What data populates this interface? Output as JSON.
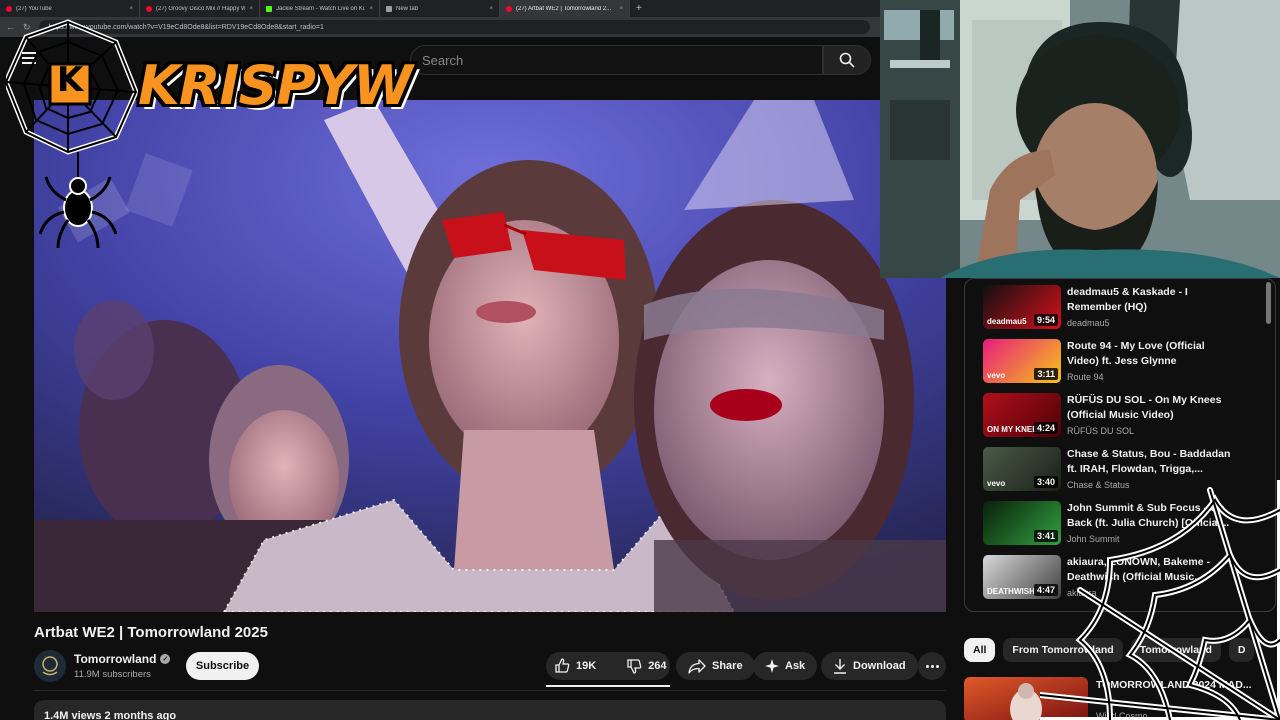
{
  "browser": {
    "tabs": [
      {
        "label": "(27) YouTube",
        "icon": "youtube-favicon",
        "active": false
      },
      {
        "label": "(27) Groovy Disco Mix // Happy W...",
        "icon": "youtube-favicon",
        "active": false
      },
      {
        "label": "Jackie Stream - Watch Live on Ki...",
        "icon": "kick-favicon",
        "active": false
      },
      {
        "label": "New tab",
        "icon": "blank-favicon",
        "active": false
      },
      {
        "label": "(27) Artbat WE2 | Tomorrowland 2...",
        "icon": "youtube-favicon",
        "active": true
      }
    ],
    "new_tab_label": "+",
    "url": "https://www.youtube.com/watch?v=V19eCd8Ode8&list=RDV19eCd8Ode8&start_radio=1"
  },
  "header": {
    "search_placeholder": "Search"
  },
  "video": {
    "title": "Artbat WE2 | Tomorrowland 2025",
    "channel": "Tomorrowland",
    "subscribers": "11.9M subscribers",
    "subscribe_label": "Subscribe",
    "like_count": "19K",
    "dislike_count": "264",
    "share_label": "Share",
    "ask_label": "Ask",
    "download_label": "Download",
    "stats": "1.4M views  2 months ago"
  },
  "playlist": [
    {
      "title": "deadmau5 & Kaskade - I Remember (HQ)",
      "channel": "deadmau5",
      "duration": "9:54",
      "thumb_text": "deadmau5",
      "colors": [
        "#101010",
        "#d8101c"
      ]
    },
    {
      "title": "Route 94 - My Love (Official Video) ft. Jess Glynne",
      "channel": "Route 94",
      "duration": "3:11",
      "thumb_text": "vevo",
      "colors": [
        "#e81c7c",
        "#f5c518"
      ]
    },
    {
      "title": "RÜFÜS DU SOL - On My Knees (Official Music Video)",
      "channel": "RÜFÜS DU SOL",
      "duration": "4:24",
      "thumb_text": "ON MY KNEES",
      "colors": [
        "#b0101a",
        "#500008"
      ]
    },
    {
      "title": "Chase & Status, Bou - Baddadan ft. IRAH, Flowdan, Trigga,...",
      "channel": "Chase & Status",
      "duration": "3:40",
      "thumb_text": "vevo",
      "colors": [
        "#4a5a48",
        "#1a2018"
      ]
    },
    {
      "title": "John Summit & Sub Focus - Go Back (ft. Julia Church) [Official...",
      "channel": "John Summit",
      "duration": "3:41",
      "thumb_text": "",
      "colors": [
        "#0a200a",
        "#30a040"
      ]
    },
    {
      "title": "akiaura, LONOWN, Bakeme - Deathwish (Official Music...",
      "channel": "akiaura",
      "duration": "4:47",
      "thumb_text": "DEATHWISH",
      "colors": [
        "#d8d8d8",
        "#404040"
      ]
    }
  ],
  "chips": [
    {
      "label": "All",
      "active": true
    },
    {
      "label": "From Tomorrowland",
      "active": false
    },
    {
      "label": "Tomorrowland",
      "active": false
    },
    {
      "label": "D",
      "active": false
    }
  ],
  "recommendation": {
    "title": "TOMORROWLAND 2024 MAD...",
    "channel": "Wind Cosmo..."
  },
  "overlay": {
    "brand": "KRISPYW",
    "brand_initial": "K"
  },
  "colors": {
    "background": "#0f0f0f",
    "brand_orange": "#f7931e",
    "youtube_red": "#ff0033"
  }
}
